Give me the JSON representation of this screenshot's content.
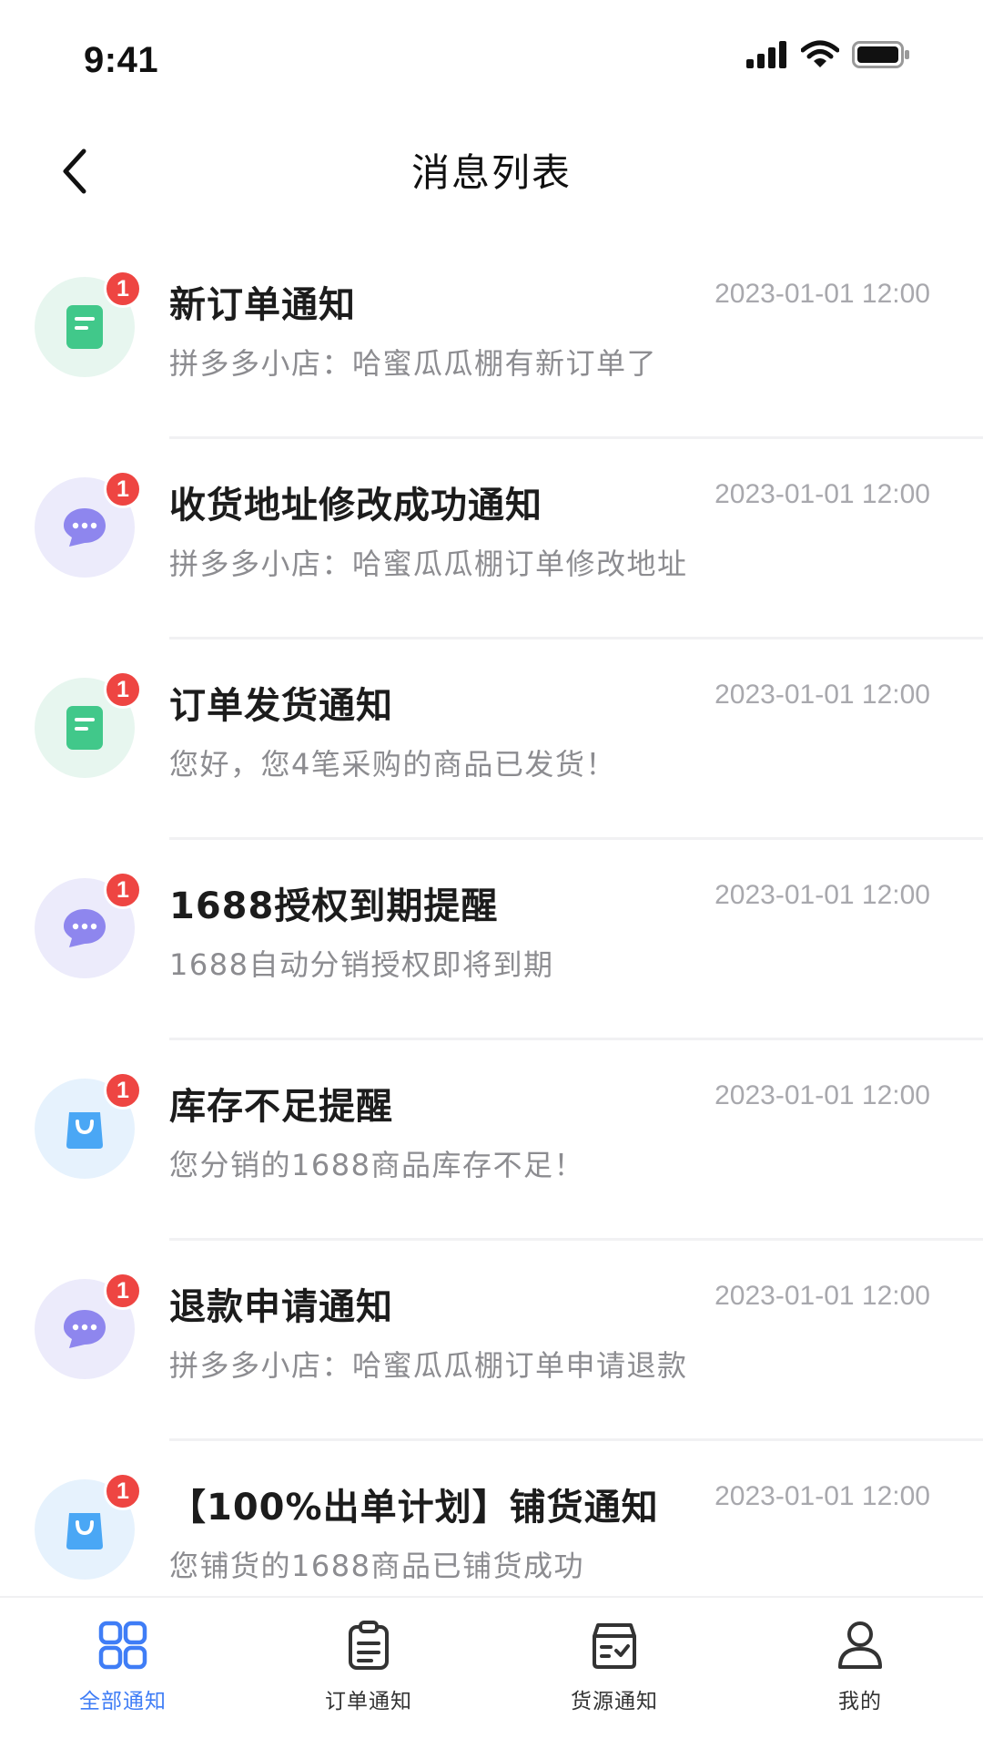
{
  "status_bar": {
    "time": "9:41"
  },
  "nav": {
    "title": "消息列表"
  },
  "messages": [
    {
      "title": "新订单通知",
      "content": "拼多多小店：哈蜜瓜瓜棚有新订单了",
      "time": "2023-01-01 12:00",
      "badge": "1",
      "icon": "document-icon",
      "color": "#41c88a"
    },
    {
      "title": "收货地址修改成功通知",
      "content": "拼多多小店：哈蜜瓜瓜棚订单修改地址",
      "time": "2023-01-01 12:00",
      "badge": "1",
      "icon": "chat-bubble-icon",
      "color": "#8e86ee"
    },
    {
      "title": "订单发货通知",
      "content": "您好，您4笔采购的商品已发货！",
      "time": "2023-01-01 12:00",
      "badge": "1",
      "icon": "document-icon",
      "color": "#41c88a"
    },
    {
      "title": "1688授权到期提醒",
      "content": "1688自动分销授权即将到期",
      "time": "2023-01-01 12:00",
      "badge": "1",
      "icon": "chat-bubble-icon",
      "color": "#8e86ee"
    },
    {
      "title": "库存不足提醒",
      "content": "您分销的1688商品库存不足！",
      "time": "2023-01-01 12:00",
      "badge": "1",
      "icon": "shopping-bag-icon",
      "color": "#4aa7f5"
    },
    {
      "title": "退款申请通知",
      "content": "拼多多小店：哈蜜瓜瓜棚订单申请退款",
      "time": "2023-01-01 12:00",
      "badge": "1",
      "icon": "chat-bubble-icon",
      "color": "#8e86ee"
    },
    {
      "title": "【100%出单计划】铺货通知",
      "content": "您铺货的1688商品已铺货成功",
      "time": "2023-01-01 12:00",
      "badge": "1",
      "icon": "shopping-bag-icon",
      "color": "#4aa7f5"
    }
  ],
  "tabs": [
    {
      "label": "全部通知",
      "icon": "grid-icon",
      "active": true
    },
    {
      "label": "订单通知",
      "icon": "clipboard-icon",
      "active": false
    },
    {
      "label": "货源通知",
      "icon": "inbox-box-icon",
      "active": false
    },
    {
      "label": "我的",
      "icon": "user-icon",
      "active": false
    }
  ],
  "colors": {
    "accent": "#3f7df6",
    "badge": "#ee4542",
    "title": "#1c1c1c",
    "subtext": "#8c8c90",
    "time": "#a8a8ad"
  }
}
